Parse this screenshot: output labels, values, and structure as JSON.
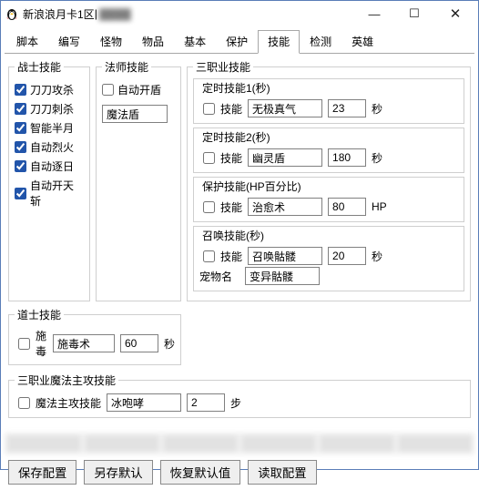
{
  "title": "新浪浪月卡1区",
  "subtitle": "▓▓▓▓",
  "winbtn": {
    "min": "—",
    "max": "☐",
    "close": "✕"
  },
  "tabs": [
    "脚本",
    "编写",
    "怪物",
    "物品",
    "基本",
    "保护",
    "技能",
    "检测",
    "英雄"
  ],
  "active_tab": 6,
  "warrior": {
    "legend": "战士技能",
    "c1": "刀刀攻杀",
    "c2": "刀刀刺杀",
    "c3": "智能半月",
    "c4": "自动烈火",
    "c5": "自动逐日",
    "c6": "自动开天斩"
  },
  "mage": {
    "legend": "法师技能",
    "c1": "自动开盾",
    "shield": "魔法盾"
  },
  "san": {
    "legend": "三职业技能",
    "g1": {
      "legend": "定时技能1(秒)",
      "chk": "技能",
      "name": "无极真气",
      "val": "23",
      "unit": "秒"
    },
    "g2": {
      "legend": "定时技能2(秒)",
      "chk": "技能",
      "name": "幽灵盾",
      "val": "180",
      "unit": "秒"
    },
    "g3": {
      "legend": "保护技能(HP百分比)",
      "chk": "技能",
      "name": "治愈术",
      "val": "80",
      "unit": "HP"
    },
    "g4": {
      "legend": "召唤技能(秒)",
      "chk": "技能",
      "name": "召唤骷髅",
      "val": "20",
      "unit": "秒",
      "pet_lbl": "宠物名",
      "pet": "变异骷髅"
    }
  },
  "tao": {
    "legend": "道士技能",
    "chk": "施毒",
    "name": "施毒术",
    "val": "60",
    "unit": "秒"
  },
  "all": {
    "legend": "三职业魔法主攻技能",
    "chk": "魔法主攻技能",
    "name": "冰咆哮",
    "val": "2",
    "unit": "步"
  },
  "btns": {
    "b1": "保存配置",
    "b2": "另存默认",
    "b3": "恢复默认值",
    "b4": "读取配置"
  }
}
